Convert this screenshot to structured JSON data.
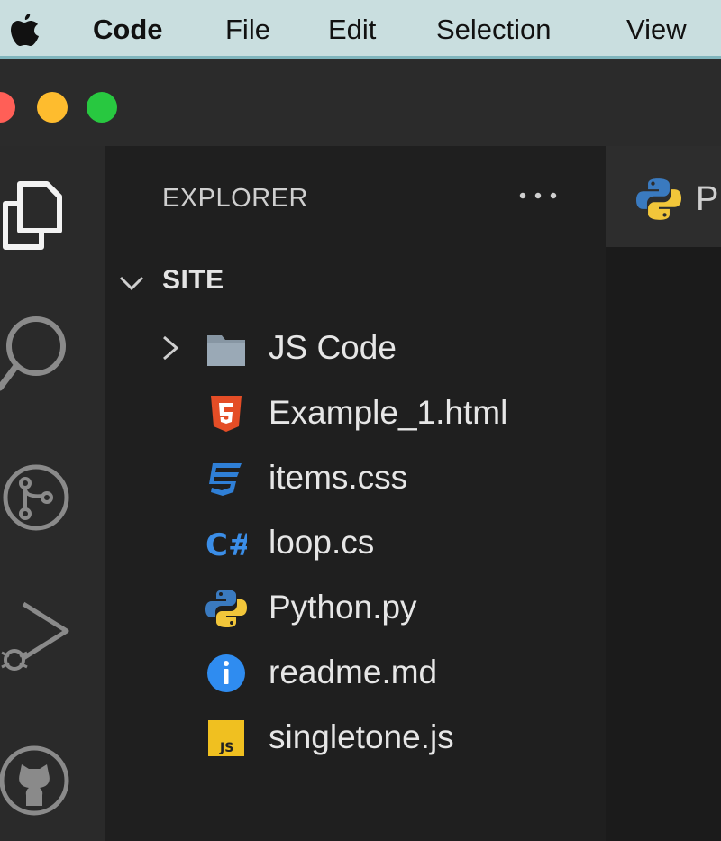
{
  "menubar": {
    "apple_icon": "apple-logo-icon",
    "items": [
      "Code",
      "File",
      "Edit",
      "Selection",
      "View"
    ]
  },
  "window": {
    "traffic_lights": {
      "close": "#ff5f57",
      "minimize": "#febc2e",
      "maximize": "#28c840"
    }
  },
  "activity_bar": {
    "icons": [
      "explorer-icon",
      "search-icon",
      "source-control-icon",
      "run-debug-icon",
      "github-icon"
    ]
  },
  "sidebar": {
    "title": "EXPLORER",
    "more_icon": "ellipsis-icon",
    "folder": {
      "name": "SITE",
      "expanded": true,
      "children": [
        {
          "name": "JS Code",
          "type": "folder",
          "icon": "folder-icon"
        },
        {
          "name": "Example_1.html",
          "type": "file",
          "icon": "html5-icon"
        },
        {
          "name": "items.css",
          "type": "file",
          "icon": "css3-icon"
        },
        {
          "name": "loop.cs",
          "type": "file",
          "icon": "csharp-icon"
        },
        {
          "name": "Python.py",
          "type": "file",
          "icon": "python-icon"
        },
        {
          "name": "readme.md",
          "type": "file",
          "icon": "info-icon"
        },
        {
          "name": "singletone.js",
          "type": "file",
          "icon": "javascript-icon"
        }
      ]
    }
  },
  "editor": {
    "active_tab": {
      "label": "P",
      "icon": "python-icon"
    }
  },
  "colors": {
    "menubar_bg": "#c9dedf",
    "titlebar_bg": "#2b2b2b",
    "sidebar_bg": "#1f1f1f",
    "html_icon": "#e44d26",
    "css_icon": "#2f7fd6",
    "csharp_icon": "#3b8ee8",
    "python_blue": "#3a7abf",
    "python_yellow": "#f2c63a",
    "info_icon": "#2f8cf0",
    "js_icon": "#f0c020"
  }
}
